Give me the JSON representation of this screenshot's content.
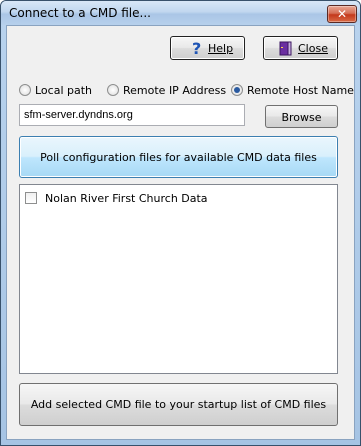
{
  "window": {
    "title": "Connect to a CMD file...",
    "close_glyph": "✕"
  },
  "toolbar": {
    "help_label": "Help",
    "close_label": "Close"
  },
  "source": {
    "options": [
      {
        "label": "Local path",
        "selected": false
      },
      {
        "label": "Remote IP Address",
        "selected": false
      },
      {
        "label": "Remote Host Name",
        "selected": true
      }
    ],
    "host_value": "sfm-server.dyndns.org",
    "browse_label": "Browse"
  },
  "poll_label": "Poll configuration files for available CMD data files",
  "files": {
    "items": [
      {
        "label": "Nolan River First Church Data",
        "checked": false
      }
    ]
  },
  "add_label": "Add selected CMD file to your startup list of CMD files",
  "colors": {
    "accent": "#2a5aa0",
    "title_close": "#c4391c",
    "help_icon": "#1f55b5",
    "close_icon": "#6b2fa0"
  }
}
